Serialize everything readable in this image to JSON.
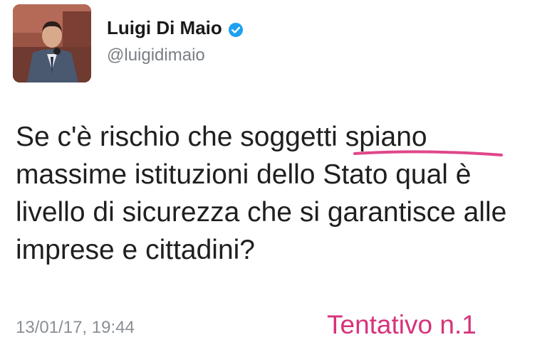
{
  "profile": {
    "display_name": "Luigi Di Maio",
    "handle": "@luigidimaio",
    "verified_icon": "verified-badge-icon"
  },
  "tweet": {
    "line1_before": "Se c'è rischio che soggetti ",
    "line1_highlight": "spiano",
    "line2": "massime istituzioni dello Stato qual è",
    "line3": "livello di sicurezza che si garantisce alle",
    "line4": "imprese e cittadini?",
    "timestamp": "13/01/17, 19:44"
  },
  "annotation": {
    "label": "Tentativo n.1",
    "color": "#d6337a"
  },
  "colors": {
    "verified": "#1da1f2",
    "muted": "#8a8f94"
  }
}
